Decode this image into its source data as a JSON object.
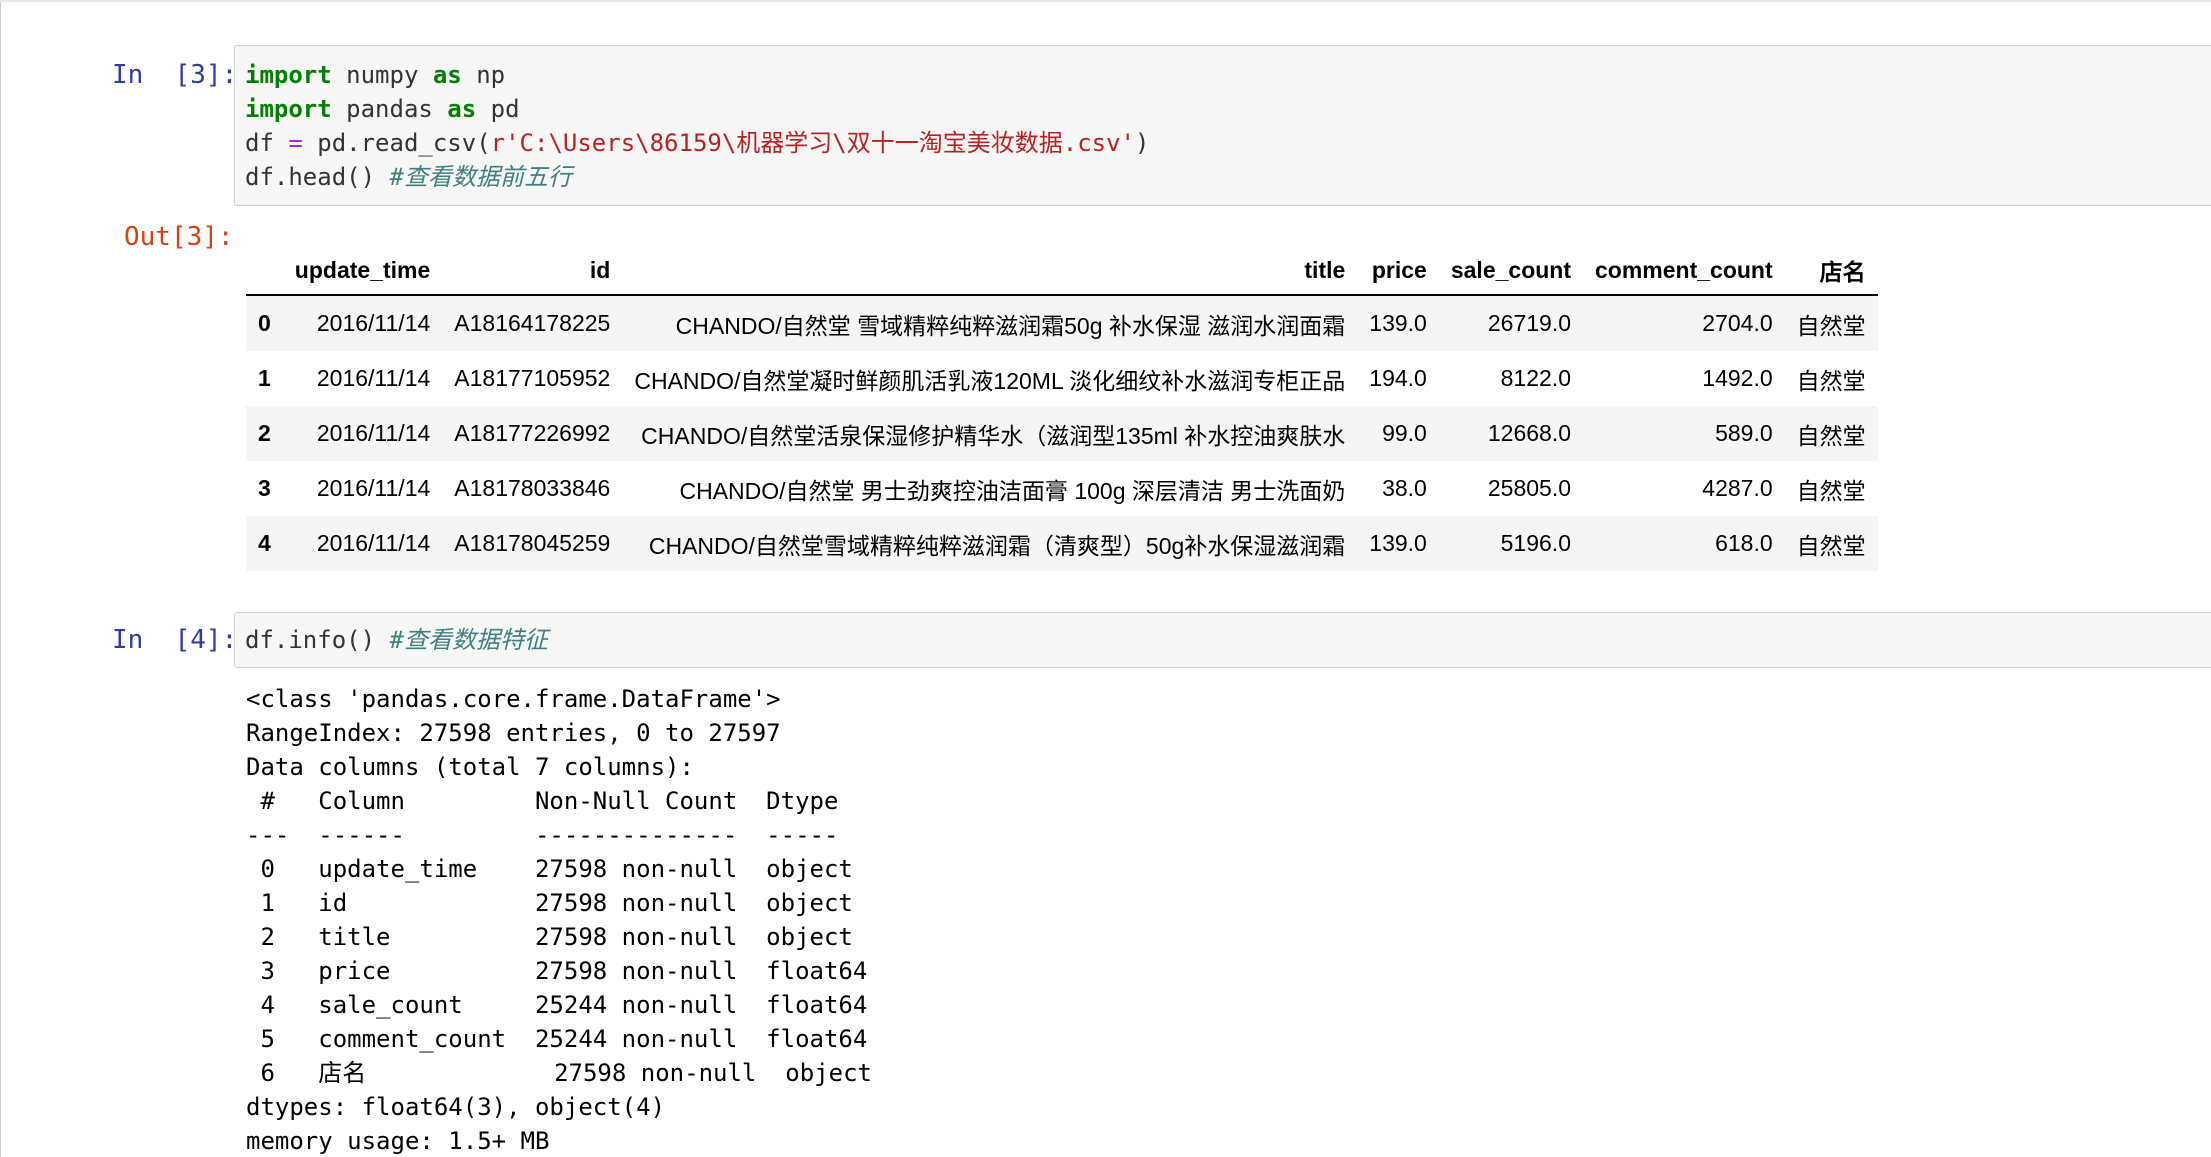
{
  "cells": {
    "cell3": {
      "in_prompt": "In  [3]:",
      "out_prompt": "Out[3]:",
      "code_lines": [
        [
          {
            "t": "import",
            "c": "kw"
          },
          {
            "t": " numpy ",
            "c": ""
          },
          {
            "t": "as",
            "c": "kw"
          },
          {
            "t": " np",
            "c": ""
          }
        ],
        [
          {
            "t": "import",
            "c": "kw"
          },
          {
            "t": " pandas ",
            "c": ""
          },
          {
            "t": "as",
            "c": "kw"
          },
          {
            "t": " pd",
            "c": ""
          }
        ],
        [
          {
            "t": "df ",
            "c": ""
          },
          {
            "t": "=",
            "c": "op"
          },
          {
            "t": " pd.read_csv(",
            "c": ""
          },
          {
            "t": "r'C:\\Users\\86159\\机器学习\\双十一淘宝美妆数据.csv'",
            "c": "str"
          },
          {
            "t": ")",
            "c": ""
          }
        ],
        [
          {
            "t": "df.head() ",
            "c": ""
          },
          {
            "t": "#查看数据前五行",
            "c": "cmt"
          }
        ]
      ],
      "table": {
        "headers": [
          "",
          "update_time",
          "id",
          "title",
          "price",
          "sale_count",
          "comment_count",
          "店名"
        ],
        "rows": [
          [
            "0",
            "2016/11/14",
            "A18164178225",
            "CHANDO/自然堂 雪域精粹纯粹滋润霜50g 补水保湿 滋润水润面霜",
            "139.0",
            "26719.0",
            "2704.0",
            "自然堂"
          ],
          [
            "1",
            "2016/11/14",
            "A18177105952",
            "CHANDO/自然堂凝时鲜颜肌活乳液120ML 淡化细纹补水滋润专柜正品",
            "194.0",
            "8122.0",
            "1492.0",
            "自然堂"
          ],
          [
            "2",
            "2016/11/14",
            "A18177226992",
            "CHANDO/自然堂活泉保湿修护精华水（滋润型135ml 补水控油爽肤水",
            "99.0",
            "12668.0",
            "589.0",
            "自然堂"
          ],
          [
            "3",
            "2016/11/14",
            "A18178033846",
            "CHANDO/自然堂 男士劲爽控油洁面膏 100g 深层清洁 男士洗面奶",
            "38.0",
            "25805.0",
            "4287.0",
            "自然堂"
          ],
          [
            "4",
            "2016/11/14",
            "A18178045259",
            "CHANDO/自然堂雪域精粹纯粹滋润霜（清爽型）50g补水保湿滋润霜",
            "139.0",
            "5196.0",
            "618.0",
            "自然堂"
          ]
        ]
      }
    },
    "cell4": {
      "in_prompt": "In  [4]:",
      "code_lines": [
        [
          {
            "t": "df.info() ",
            "c": ""
          },
          {
            "t": "#查看数据特征",
            "c": "cmt"
          }
        ]
      ],
      "output": "<class 'pandas.core.frame.DataFrame'>\nRangeIndex: 27598 entries, 0 to 27597\nData columns (total 7 columns):\n #   Column         Non-Null Count  Dtype  \n---  ------         --------------  -----  \n 0   update_time    27598 non-null  object \n 1   id             27598 non-null  object \n 2   title          27598 non-null  object \n 3   price          27598 non-null  float64\n 4   sale_count     25244 non-null  float64\n 5   comment_count  25244 non-null  float64\n 6   店名             27598 non-null  object \ndtypes: float64(3), object(4)\nmemory usage: 1.5+ MB"
    }
  },
  "colors": {
    "in_prompt": "#303f9f",
    "out_prompt": "#d84315",
    "keyword": "#008000",
    "operator": "#aa22ff",
    "string": "#ba2121",
    "comment": "#408080"
  }
}
